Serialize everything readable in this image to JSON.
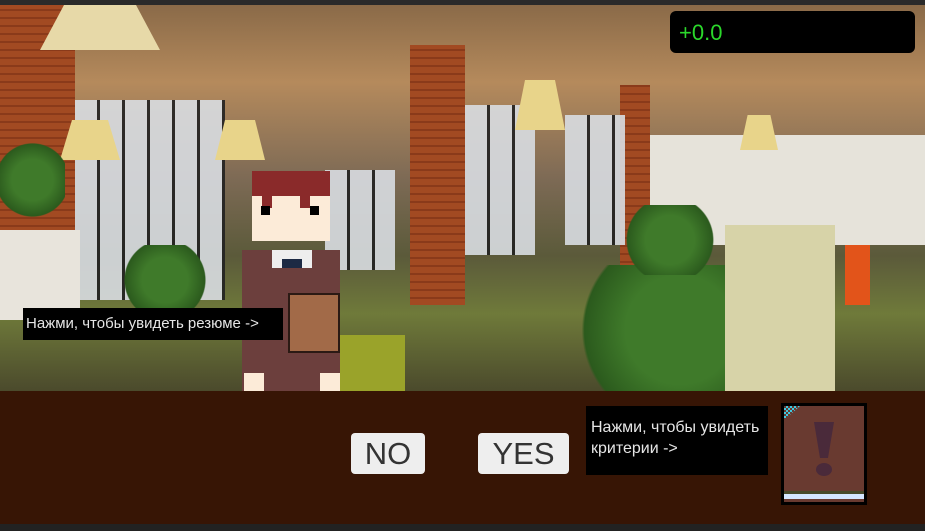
{
  "hud": {
    "score": "+0.0"
  },
  "resume_hint": "Нажми, чтобы увидеть резюме ->",
  "criteria_hint": "Нажми, чтобы увидеть критерии ->",
  "buttons": {
    "no": "NO",
    "yes": "YES"
  },
  "colors": {
    "panel": "#371505",
    "score_text": "#2bd82b",
    "book": "#693a30"
  }
}
